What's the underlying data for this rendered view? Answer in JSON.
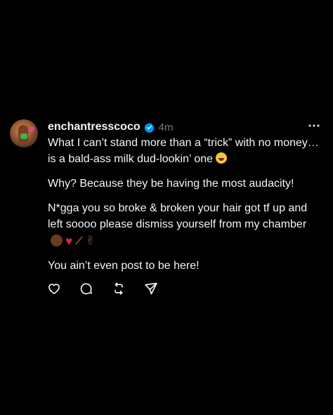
{
  "post": {
    "username": "enchantresscoco",
    "verified": true,
    "timestamp": "4m",
    "paragraphs": [
      {
        "text": "What I can’t stand more than a “trick” with no money… is a bald-ass milk dud-lookin’ one",
        "emoji": "😂"
      },
      {
        "text": "Why? Because they be having the most audacity!"
      },
      {
        "text": "N*gga you so broke & broken your hair got tf up and left soooo please dismiss yourself from my chamber",
        "emoji": "👨🏾💔🧹✌🏾"
      },
      {
        "text": "You ain’t even post to be here!"
      }
    ],
    "actions": [
      "heart-icon",
      "comment-icon",
      "repost-icon",
      "share-icon"
    ]
  },
  "colors": {
    "background": "#000000",
    "text": "#f3f5f7",
    "muted": "#7a7a7a",
    "verified": "#0095f6"
  }
}
